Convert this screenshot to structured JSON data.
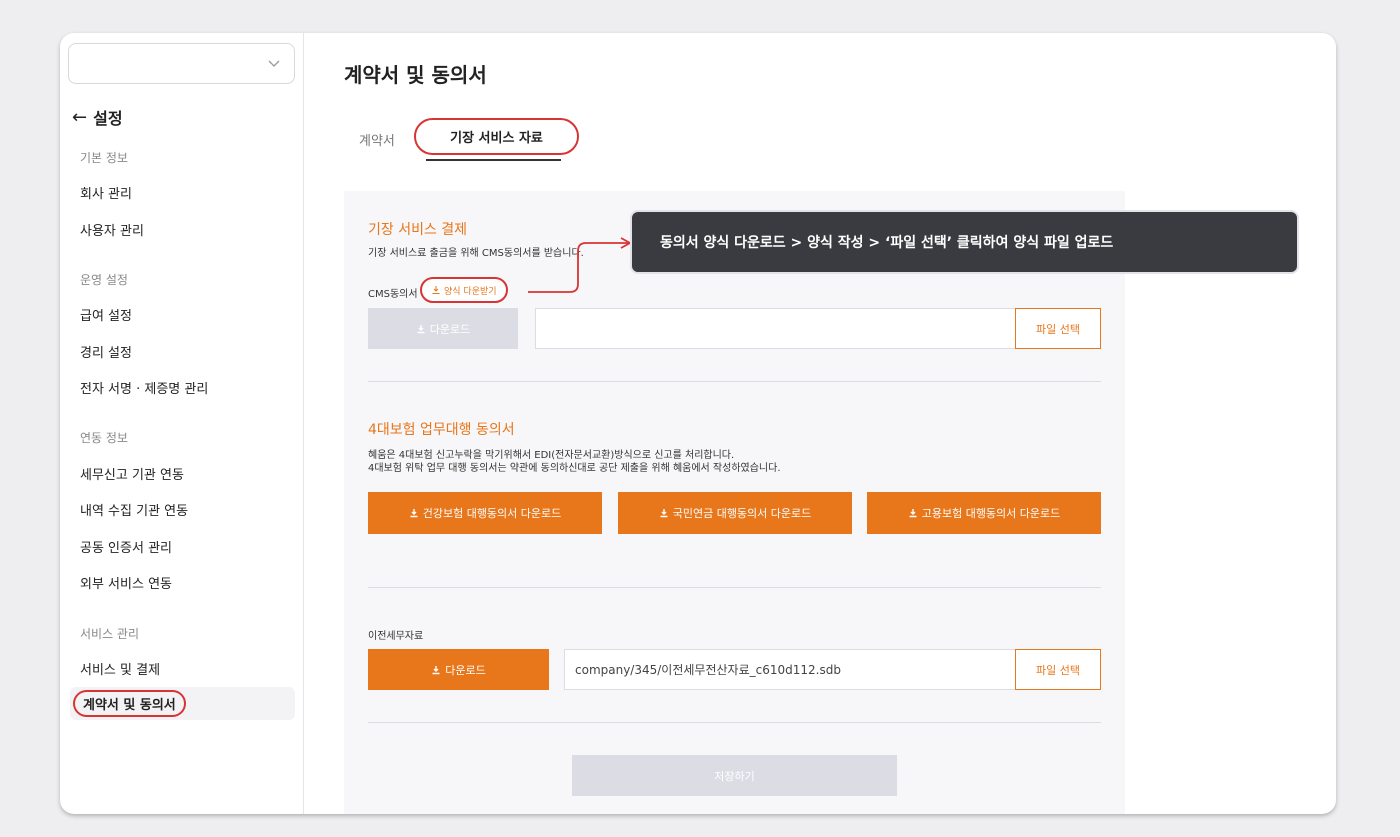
{
  "sidebar": {
    "select_value": "",
    "back_label": "설정",
    "groups": {
      "basic": "기본 정보",
      "company": "회사 관리",
      "users": "사용자 관리",
      "ops": "운영 설정",
      "payroll": "급여 설정",
      "accounting": "경리 설정",
      "esign": "전자 서명 · 제증명 관리",
      "link": "연동 정보",
      "tax_link": "세무신고 기관 연동",
      "history_link": "내역 수집 기관 연동",
      "cert": "공동 인증서 관리",
      "external": "외부 서비스 연동",
      "service": "서비스 관리",
      "service_pay": "서비스 및 결제",
      "contracts": "계약서 및 동의서"
    }
  },
  "main": {
    "title": "계약서 및 동의서",
    "tabs": [
      "계약서",
      "기장 서비스 자료"
    ]
  },
  "section1": {
    "title": "기장 서비스 결제",
    "desc": "기장 서비스료 출금을 위해 CMS동의서를 받습니다.",
    "field_label": "CMS동의서",
    "form_download": "양식 다운받기",
    "download_btn": "다운로드",
    "file_value": "",
    "file_btn": "파일 선택"
  },
  "section2": {
    "title": "4대보험 업무대행 동의서",
    "desc1": "혜움은 4대보험 신고누락을 막기위해서 EDI(전자문서교환)방식으로 신고를 처리합니다.",
    "desc2": "4대보험 위탁 업무 대행 동의서는 약관에 동의하신대로 공단 제출을 위해 혜움에서 작성하였습니다.",
    "btn_health": "건강보험 대행동의서 다운로드",
    "btn_pension": "국민연금 대행동의서 다운로드",
    "btn_employment": "고용보험 대행동의서 다운로드"
  },
  "section3": {
    "label": "이전세무자료",
    "download_btn": "다운로드",
    "file_value": "company/345/이전세무전산자료_c610d112.sdb",
    "file_btn": "파일 선택"
  },
  "save_btn": "저장하기",
  "tooltip": "동의서 양식 다운로드 > 양식 작성 > ‘파일 선택’ 클릭하여 양식 파일 업로드",
  "colors": {
    "accent": "#e8761a",
    "highlight": "#d83434",
    "tooltip_bg": "#3a3b40"
  }
}
